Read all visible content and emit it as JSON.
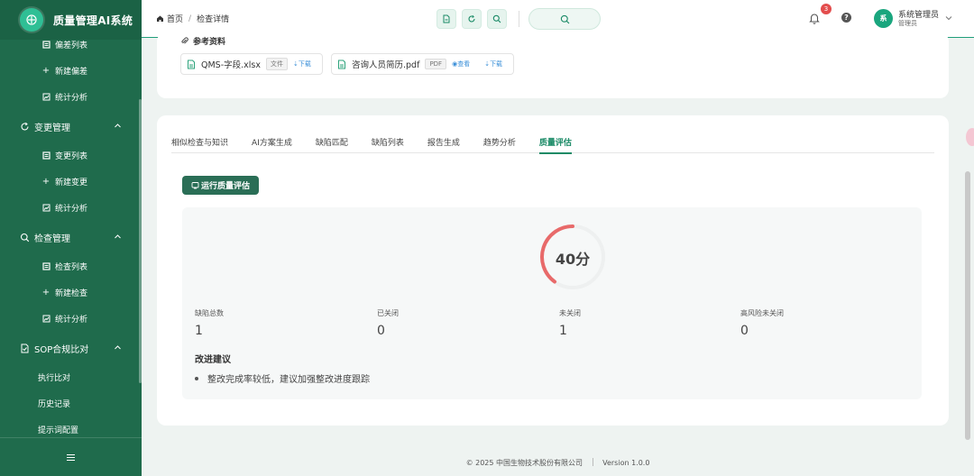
{
  "app": {
    "title": "质量管理AI系统"
  },
  "sidebar": {
    "items": [
      {
        "kind": "sub",
        "icon": "list-icon",
        "label": "偏差列表"
      },
      {
        "kind": "sub",
        "icon": "plus-icon",
        "label": "新建偏差"
      },
      {
        "kind": "sub",
        "icon": "chart-icon",
        "label": "统计分析"
      },
      {
        "kind": "group",
        "icon": "refresh-icon",
        "label": "变更管理"
      },
      {
        "kind": "sub",
        "icon": "list-icon",
        "label": "变更列表"
      },
      {
        "kind": "sub",
        "icon": "plus-icon",
        "label": "新建变更"
      },
      {
        "kind": "sub",
        "icon": "chart-icon",
        "label": "统计分析"
      },
      {
        "kind": "group",
        "icon": "search-icon",
        "label": "检查管理"
      },
      {
        "kind": "sub",
        "icon": "list-icon",
        "label": "检查列表"
      },
      {
        "kind": "sub",
        "icon": "plus-icon",
        "label": "新建检查"
      },
      {
        "kind": "sub",
        "icon": "chart-icon",
        "label": "统计分析"
      },
      {
        "kind": "group",
        "icon": "doc-check-icon",
        "label": "SOP合规比对"
      },
      {
        "kind": "plain",
        "label": "执行比对"
      },
      {
        "kind": "plain",
        "label": "历史记录"
      },
      {
        "kind": "plain",
        "label": "提示词配置"
      }
    ]
  },
  "header": {
    "breadcrumb": {
      "home": "首页",
      "current": "检查详情"
    },
    "notifications": "3",
    "user": {
      "avatar": "系",
      "name": "系统管理员",
      "role": "管理员"
    }
  },
  "references": {
    "title": "参考资料",
    "files": [
      {
        "name": "QMS-字段.xlsx",
        "type": "文件",
        "download": "下载"
      },
      {
        "name": "咨询人员简历.pdf",
        "type": "PDF",
        "view": "查看",
        "download": "下载"
      }
    ]
  },
  "tabs": [
    "相似检查与知识",
    "AI方案生成",
    "缺陷匹配",
    "缺陷列表",
    "报告生成",
    "趋势分析",
    "质量评估"
  ],
  "active_tab": "质量评估",
  "evaluation": {
    "run_button": "运行质量评估",
    "score_text": "40分",
    "score": 40,
    "stats": [
      {
        "label": "缺陷总数",
        "value": "1"
      },
      {
        "label": "已关闭",
        "value": "0"
      },
      {
        "label": "未关闭",
        "value": "1"
      },
      {
        "label": "高风险未关闭",
        "value": "0"
      }
    ],
    "suggestions_title": "改进建议",
    "suggestions": [
      "整改完成率较低，建议加强整改进度跟踪"
    ]
  },
  "footer": {
    "copyright": "© 2025 中国生物技术股份有限公司",
    "version": "Version 1.0.0"
  },
  "colors": {
    "sidebar": "#1f6b4c",
    "accent": "#1a8a66",
    "gauge": "#e86a6a"
  }
}
